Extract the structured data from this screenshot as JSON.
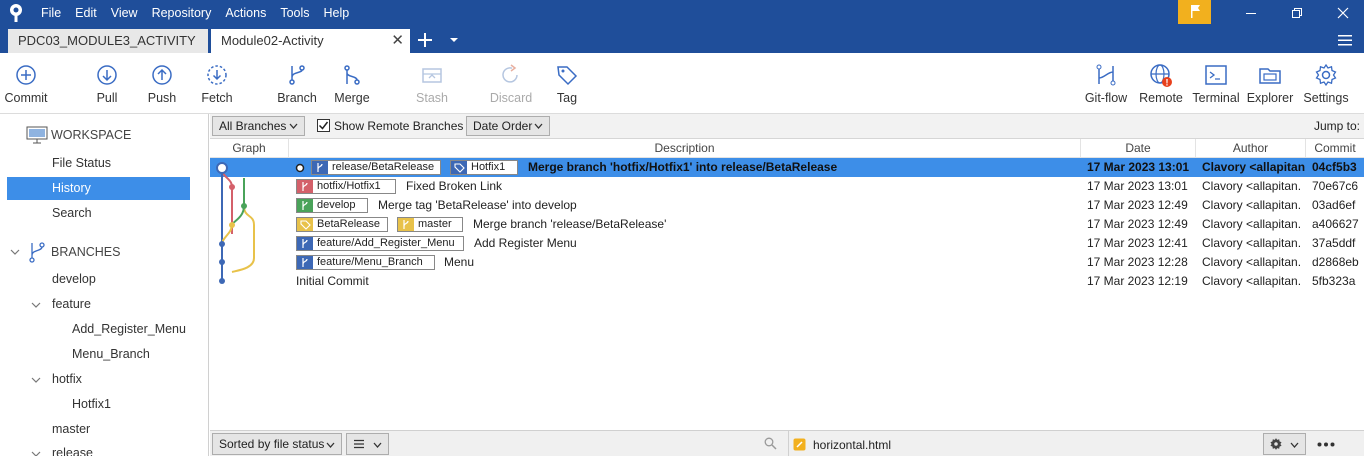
{
  "menu": [
    "File",
    "Edit",
    "View",
    "Repository",
    "Actions",
    "Tools",
    "Help"
  ],
  "tabs": [
    {
      "label": "PDC03_MODULE3_ACTIVITY"
    },
    {
      "label": "Module02-Activity",
      "close": "✕"
    }
  ],
  "toolbar": {
    "commit": "Commit",
    "pull": "Pull",
    "push": "Push",
    "fetch": "Fetch",
    "branch": "Branch",
    "merge": "Merge",
    "stash": "Stash",
    "discard": "Discard",
    "tag": "Tag",
    "gitflow": "Git-flow",
    "remote": "Remote",
    "terminal": "Terminal",
    "explorer": "Explorer",
    "settings": "Settings"
  },
  "sidebar": {
    "workspace": "WORKSPACE",
    "file_status": "File Status",
    "history": "History",
    "search": "Search",
    "branches": "BRANCHES",
    "develop": "develop",
    "feature": "feature",
    "add_register_menu": "Add_Register_Menu",
    "menu_branch": "Menu_Branch",
    "hotfix": "hotfix",
    "hotfix1": "Hotfix1",
    "master": "master",
    "release": "release"
  },
  "filters": {
    "branches": "All Branches",
    "show_remote": "Show Remote Branches",
    "order": "Date Order",
    "jump": "Jump to:"
  },
  "columns": {
    "graph": "Graph",
    "description": "Description",
    "date": "Date",
    "author": "Author",
    "commit": "Commit"
  },
  "commits": [
    {
      "badges": [
        "release/BetaRelease",
        "Hotfix1"
      ],
      "message": "Merge branch 'hotfix/Hotfix1' into release/BetaRelease",
      "date": "17 Mar 2023 13:01",
      "author": "Clavory <allapitan",
      "hash": "04cf5b3"
    },
    {
      "badges": [
        "hotfix/Hotfix1"
      ],
      "message": "Fixed Broken Link",
      "date": "17 Mar 2023 13:01",
      "author": "Clavory <allapitan.",
      "hash": "70e67c6"
    },
    {
      "badges": [
        "develop"
      ],
      "message": "Merge tag 'BetaRelease' into develop",
      "date": "17 Mar 2023 12:49",
      "author": "Clavory <allapitan.",
      "hash": "03ad6ef"
    },
    {
      "badges": [
        "BetaRelease",
        "master"
      ],
      "message": "Merge branch 'release/BetaRelease'",
      "date": "17 Mar 2023 12:49",
      "author": "Clavory <allapitan.",
      "hash": "a406627"
    },
    {
      "badges": [
        "feature/Add_Register_Menu"
      ],
      "message": "Add Register Menu",
      "date": "17 Mar 2023 12:41",
      "author": "Clavory <allapitan.",
      "hash": "37a5ddf"
    },
    {
      "badges": [
        "feature/Menu_Branch"
      ],
      "message": "Menu",
      "date": "17 Mar 2023 12:28",
      "author": "Clavory <allapitan.",
      "hash": "d2868eb"
    },
    {
      "badges": [],
      "message": "Initial Commit",
      "date": "17 Mar 2023 12:19",
      "author": "Clavory <allapitan.",
      "hash": "5fb323a"
    }
  ],
  "bottom": {
    "sort": "Sorted by file status",
    "file": "horizontal.html"
  },
  "colors": {
    "chrome": "#1f4e9a",
    "selection": "#3d8ee8",
    "flag": "#f2b01e",
    "remote_alert": "#e8401c"
  },
  "icons": {
    "branch_badge": "branch-icon",
    "tag_badge": "tag-icon",
    "notification": "flag-icon",
    "remote_alert": "alert-icon"
  }
}
